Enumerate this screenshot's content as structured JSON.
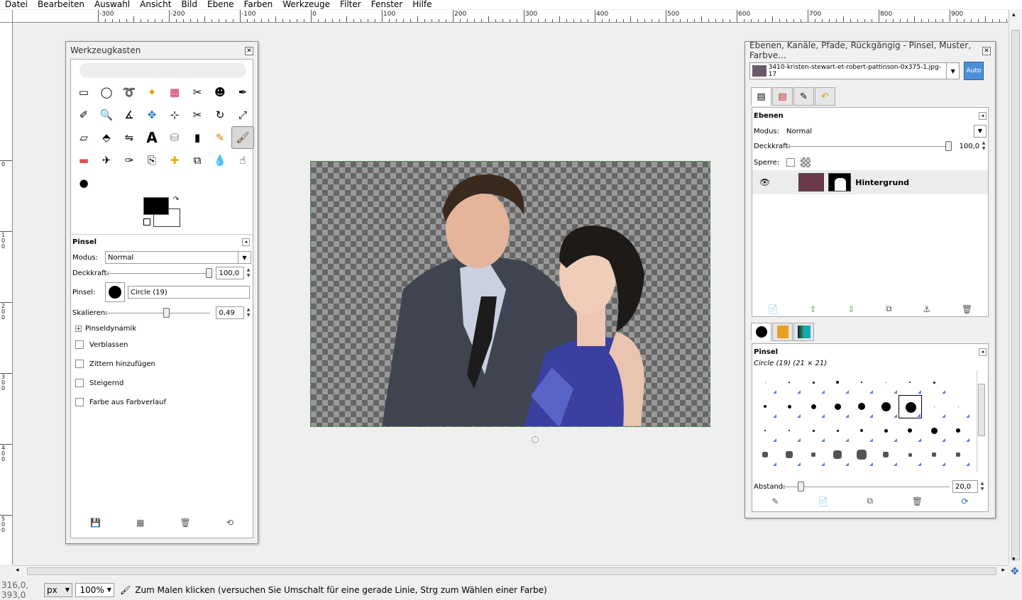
{
  "menu": [
    "Datei",
    "Bearbeiten",
    "Auswahl",
    "Ansicht",
    "Bild",
    "Ebene",
    "Farben",
    "Werkzeuge",
    "Filter",
    "Fenster",
    "Hilfe"
  ],
  "ruler": {
    "h_labels": [
      "-300",
      "-200",
      "-100",
      "0",
      "100",
      "200",
      "300",
      "400",
      "500",
      "600",
      "700",
      "800",
      "900"
    ],
    "v_labels": [
      "0",
      "100",
      "200",
      "300",
      "400",
      "500"
    ]
  },
  "toolbox": {
    "title": "Werkzeugkasten",
    "tool_icons": [
      "rect-select-icon",
      "ellipse-select-icon",
      "lasso-icon",
      "fuzzy-select-icon",
      "color-select-icon",
      "scissors-icon",
      "foreground-select-icon",
      "paths-icon",
      "color-picker-icon",
      "zoom-icon",
      "measure-icon",
      "move-icon",
      "align-icon",
      "crop-icon",
      "rotate-icon",
      "scale-icon",
      "shear-icon",
      "perspective-icon",
      "flip-icon",
      "text-icon",
      "bucket-fill-icon",
      "blend-icon",
      "pencil-icon",
      "paintbrush-icon",
      "eraser-icon",
      "airbrush-icon",
      "ink-icon",
      "clone-icon",
      "heal-icon",
      "perspective-clone-icon",
      "blur-icon",
      "smudge-icon",
      "dodge-burn-icon"
    ],
    "options_title": "Pinsel",
    "mode_label": "Modus:",
    "mode_value": "Normal",
    "opacity_label": "Deckkraft:",
    "opacity_value": "100,0",
    "brush_label": "Pinsel:",
    "brush_value": "Circle (19)",
    "scale_label": "Skalieren:",
    "scale_value": "0,49",
    "dynamics_label": "Pinseldynamik",
    "checkboxes": [
      "Verblassen",
      "Zittern hinzufügen",
      "Steigernd",
      "Farbe aus Farbverlauf"
    ],
    "fg_color": "#000000",
    "bg_color": "#ffffff"
  },
  "dock": {
    "title": "Ebenen, Kanäle, Pfade, Rückgängig - Pinsel, Muster, Farbve...",
    "image_name": "3410-kristen-stewart-et-robert-pattinson-0x375-1.jpg-17",
    "auto_label": "Auto",
    "layers_title": "Ebenen",
    "mode_label": "Modus:",
    "mode_value": "Normal",
    "opacity_label": "Deckkraft:",
    "opacity_value": "100,0",
    "lock_label": "Sperre:",
    "layer_name": "Hintergrund",
    "brushes_title": "Pinsel",
    "brush_selected": "Circle (19) (21 × 21)",
    "spacing_label": "Abstand:",
    "spacing_value": "20,0"
  },
  "status": {
    "coords": "316,0, 393,0",
    "unit": "px",
    "zoom": "100%",
    "message": "Zum Malen klicken (versuchen Sie Umschalt für eine gerade Linie, Strg zum Wählen einer Farbe)"
  }
}
